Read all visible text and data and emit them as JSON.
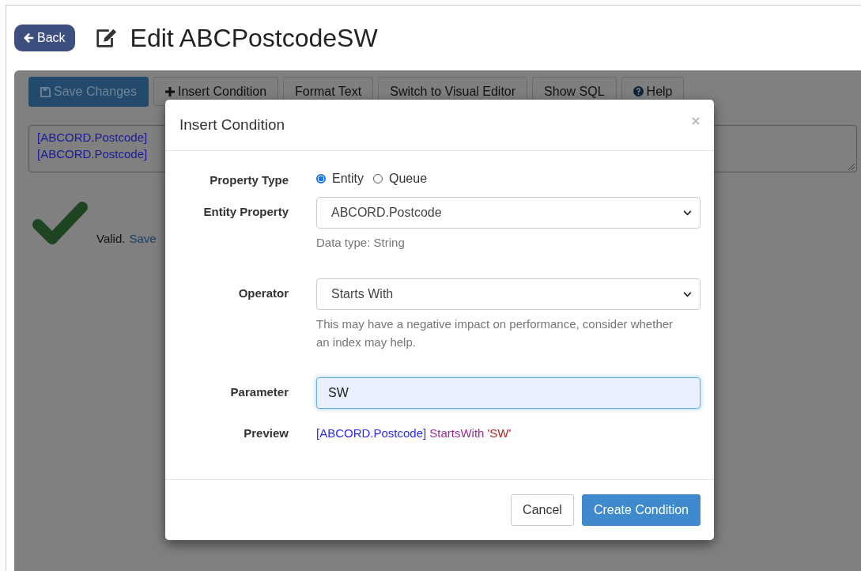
{
  "header": {
    "back_button": "Back",
    "title": "Edit ABCPostcodeSW"
  },
  "toolbar": [
    {
      "label": "Save Changes",
      "kind": "primary"
    },
    {
      "label": "Insert Condition",
      "kind": "default"
    },
    {
      "label": "Format Text",
      "kind": "default"
    },
    {
      "label": "Switch to Visual Editor",
      "kind": "default"
    },
    {
      "label": "Show SQL",
      "kind": "default"
    },
    {
      "label": "Help",
      "kind": "default"
    }
  ],
  "editor": {
    "lines": [
      "[ABCORD.Postcode]",
      "[ABCORD.Postcode]"
    ]
  },
  "validation": {
    "status": "Valid.",
    "link": "Save"
  },
  "dialog": {
    "title": "Insert Condition",
    "property_type": {
      "label": "Property Type",
      "options": [
        {
          "label": "Entity",
          "selected": true
        },
        {
          "label": "Queue",
          "selected": false
        }
      ]
    },
    "entity_property": {
      "label": "Entity Property",
      "value": "ABCORD.Postcode",
      "help": "Data type: String"
    },
    "operator": {
      "label": "Operator",
      "value": "Starts With",
      "help": "This may have a negative impact on performance, consider whether an index may help."
    },
    "parameter": {
      "label": "Parameter",
      "value": "SW"
    },
    "preview": {
      "label": "Preview",
      "parts": [
        {
          "text": "[ABCORD.Postcode]",
          "color": "#2a2af0"
        },
        {
          "text": "StartsWith",
          "color": "#9b2a9b"
        },
        {
          "text": "'SW'",
          "color": "#b22222"
        }
      ]
    },
    "buttons": [
      {
        "label": "Cancel",
        "kind": "default"
      },
      {
        "label": "Create Condition",
        "kind": "primary"
      }
    ]
  }
}
